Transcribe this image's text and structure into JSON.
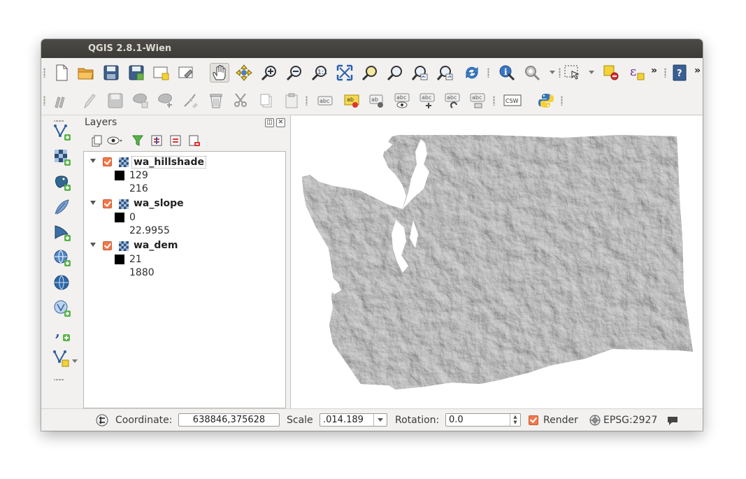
{
  "window": {
    "title": "QGIS 2.8.1-Wien"
  },
  "toolbar1": {
    "icons": [
      "new-project-icon",
      "open-project-icon",
      "save-project-icon",
      "save-as-icon",
      "new-print-composer-icon",
      "composer-manager-icon",
      "pan-icon",
      "pan-to-selection-icon",
      "zoom-in-icon",
      "zoom-out-icon",
      "zoom-native-icon",
      "zoom-full-icon",
      "zoom-to-layer-icon",
      "zoom-to-selection-icon",
      "zoom-last-icon",
      "zoom-next-icon",
      "refresh-icon",
      "identify-icon",
      "run-action-icon",
      "select-features-icon",
      "deselect-icon",
      "expression-icon",
      "help-icon"
    ],
    "overflow": "»"
  },
  "toolbar2": {
    "icons": [
      "edit-icon",
      "toggle-editing-icon",
      "save-edits-icon",
      "add-feature-icon",
      "move-feature-icon",
      "node-tool-icon",
      "delete-selected-icon",
      "cut-features-icon",
      "copy-features-icon",
      "paste-features-icon",
      "label-icon",
      "pin-labels-icon",
      "highlight-pinned-labels-icon",
      "show-hide-labels-icon",
      "move-label-icon",
      "rotate-label-icon",
      "change-label-icon",
      "csw-icon",
      "python-console-icon"
    ],
    "csw_label": "CSW"
  },
  "layers_panel": {
    "title": "Layers",
    "layers": [
      {
        "name": "wa_hillshade",
        "checked": true,
        "min": "129",
        "max": "216"
      },
      {
        "name": "wa_slope",
        "checked": true,
        "min": "0",
        "max": "22.9955"
      },
      {
        "name": "wa_dem",
        "checked": true,
        "min": "21",
        "max": "1880"
      }
    ]
  },
  "statusbar": {
    "coordinate_label": "Coordinate:",
    "coordinate_value": "638846,375628",
    "scale_label": "Scale",
    "scale_value": ".014.189",
    "rotation_label": "Rotation:",
    "rotation_value": "0.0",
    "render_label": "Render",
    "render_checked": true,
    "crs_label": "EPSG:2927"
  },
  "colors": {
    "checkbox": "#f0784a",
    "titlebar": "#3c3b37",
    "hillshade": "#8a8a8a"
  }
}
